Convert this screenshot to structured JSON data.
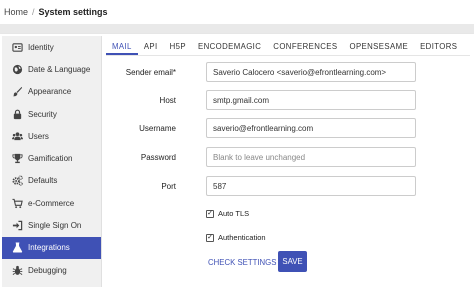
{
  "breadcrumb": {
    "home": "Home",
    "separator": "/",
    "current": "System settings"
  },
  "sidebar": {
    "items": [
      {
        "label": "Identity",
        "icon": "id-card-icon",
        "active": false
      },
      {
        "label": "Date & Language",
        "icon": "globe-icon",
        "active": false
      },
      {
        "label": "Appearance",
        "icon": "paintbrush-icon",
        "active": false
      },
      {
        "label": "Security",
        "icon": "lock-icon",
        "active": false
      },
      {
        "label": "Users",
        "icon": "users-icon",
        "active": false
      },
      {
        "label": "Gamification",
        "icon": "trophy-icon",
        "active": false
      },
      {
        "label": "Defaults",
        "icon": "gears-icon",
        "active": false
      },
      {
        "label": "e-Commerce",
        "icon": "cart-icon",
        "active": false
      },
      {
        "label": "Single Sign On",
        "icon": "sign-in-icon",
        "active": false
      },
      {
        "label": "Integrations",
        "icon": "flask-icon",
        "active": true
      },
      {
        "label": "Debugging",
        "icon": "bug-icon",
        "active": false
      }
    ]
  },
  "tabs": [
    "MAIL",
    "API",
    "H5P",
    "ENCODEMAGIC",
    "CONFERENCES",
    "OPENSESAME",
    "EDITORS"
  ],
  "active_tab": "MAIL",
  "form": {
    "sender_email": {
      "label": "Sender email*",
      "value": "Saverio Calocero <saverio@efrontlearning.com>"
    },
    "host": {
      "label": "Host",
      "value": "smtp.gmail.com"
    },
    "username": {
      "label": "Username",
      "value": "saverio@efrontlearning.com"
    },
    "password": {
      "label": "Password",
      "placeholder": "Blank to leave unchanged"
    },
    "port": {
      "label": "Port",
      "value": "587"
    },
    "auto_tls": {
      "label": "Auto TLS",
      "checked": true
    },
    "authentication": {
      "label": "Authentication",
      "checked": true
    }
  },
  "buttons": {
    "check_settings": "CHECK SETTINGS",
    "save": "SAVE"
  },
  "colors": {
    "accent": "#3f51b5",
    "sidebar_bg": "#f0f0f0",
    "header_bar": "#e9e9e9"
  }
}
